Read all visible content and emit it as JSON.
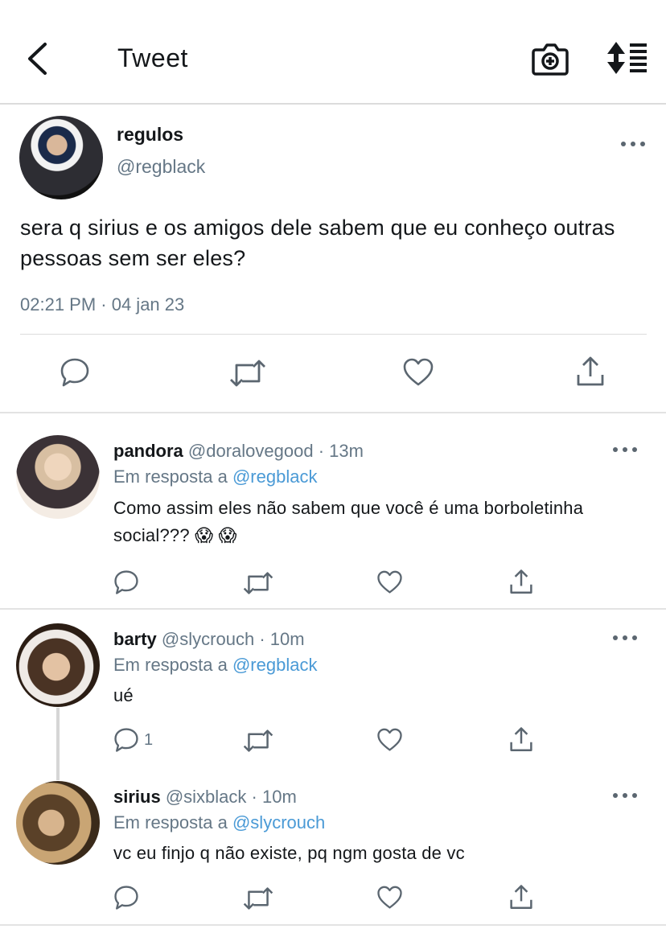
{
  "header": {
    "title": "Tweet",
    "back_icon": "chevron-left-icon",
    "camera_icon": "camera-plus-icon",
    "sort_icon": "sort-list-icon"
  },
  "main_tweet": {
    "name": "regulos",
    "handle": "@regblack",
    "text": "sera q sirius e os amigos dele sabem que eu conheço outras pessoas sem ser eles?",
    "timestamp": "02:21 PM · 04 jan 23"
  },
  "replies": [
    {
      "name": "pandora",
      "handle": "@doralovegood",
      "time": "· 13m",
      "in_reply_prefix": "Em resposta a",
      "in_reply_to": "@regblack",
      "text": "Como assim eles não sabem que você é uma borboletinha social??? 😱 😱",
      "reply_count": ""
    },
    {
      "name": "barty",
      "handle": "@slycrouch",
      "time": "· 10m",
      "in_reply_prefix": "Em resposta a",
      "in_reply_to": "@regblack",
      "text": "ué",
      "reply_count": "1"
    },
    {
      "name": "sirius",
      "handle": "@sixblack",
      "time": "· 10m",
      "in_reply_prefix": "Em resposta a",
      "in_reply_to": "@slycrouch",
      "text": "vc eu finjo q não existe, pq ngm gosta de vc",
      "reply_count": ""
    }
  ],
  "colors": {
    "text": "#14171a",
    "secondary": "#657786",
    "mention": "#4a9ad6",
    "divider": "#dcdcdc"
  }
}
